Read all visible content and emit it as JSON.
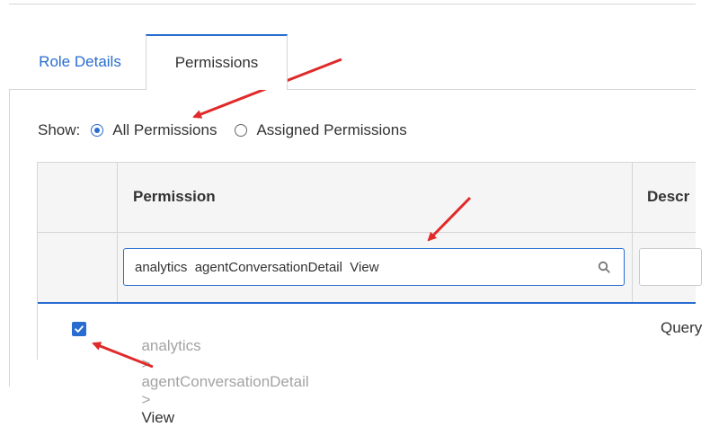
{
  "tabs": [
    {
      "label": "Role Details",
      "active": false
    },
    {
      "label": "Permissions",
      "active": true
    }
  ],
  "show_filter": {
    "label": "Show:",
    "options": [
      {
        "label": "All Permissions",
        "selected": true
      },
      {
        "label": "Assigned Permissions",
        "selected": false
      }
    ]
  },
  "table": {
    "columns": [
      {
        "label": ""
      },
      {
        "label": "Permission"
      },
      {
        "label": "Descr"
      }
    ],
    "filter": {
      "permission_value": "analytics  agentConversationDetail  View",
      "description_value": ""
    },
    "rows": [
      {
        "checked": true,
        "path": [
          "analytics",
          "agentConversationDetail",
          "View"
        ],
        "path_separator": ">",
        "description": "Query"
      }
    ]
  },
  "icons": {
    "search": "search-icon",
    "checkbox": "checkmark-icon",
    "annotation": "red-arrow"
  },
  "colors": {
    "accent": "#2a6dd0",
    "annotation_arrow": "#e02a2a",
    "header_bg": "#f5f5f5",
    "border": "#d6d6d6",
    "muted_text": "#a3a3a3"
  }
}
